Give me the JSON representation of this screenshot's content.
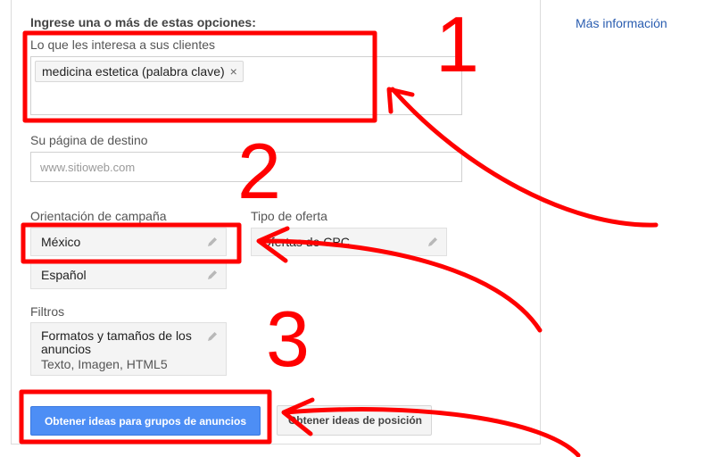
{
  "form": {
    "heading": "Ingrese una o más de estas opciones:",
    "interests_label": "Lo que les interesa a sus clientes",
    "keyword_chip": "medicina estetica (palabra clave)",
    "chip_remove": "×",
    "landing_label": "Su página de destino",
    "landing_placeholder": "www.sitioweb.com",
    "targeting_label": "Orientación de campaña",
    "location_value": "México",
    "language_value": "Español",
    "bid_label": "Tipo de oferta",
    "bid_value": "Ofertas de CPC",
    "filters_label": "Filtros",
    "filters_title": "Formatos y tamaños de los anuncios",
    "filters_value": "Texto, Imagen, HTML5",
    "primary_button": "Obtener ideas para grupos de anuncios",
    "secondary_button": "Obtener ideas de posición"
  },
  "sidebar": {
    "more_info_link": "Más información"
  },
  "annotations": {
    "step1": "1",
    "step2": "2",
    "step3": "3",
    "color": "#ff0000"
  },
  "colors": {
    "primary_button": "#4d8ef5",
    "link": "#2a5db0"
  }
}
